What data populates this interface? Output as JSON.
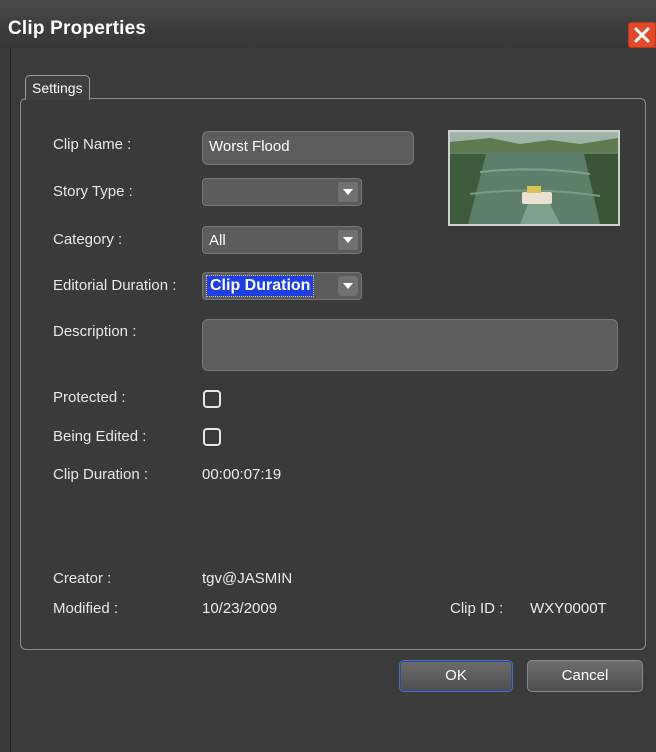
{
  "window": {
    "title": "Clip Properties"
  },
  "tabs": [
    {
      "label": "Settings"
    }
  ],
  "form": {
    "clip_name_label": "Clip Name :",
    "clip_name_value": "Worst Flood",
    "story_type_label": "Story Type :",
    "story_type_value": "",
    "category_label": "Category :",
    "category_value": "All",
    "editorial_duration_label": "Editorial Duration :",
    "editorial_duration_value": "Clip Duration",
    "description_label": "Description :",
    "description_value": "",
    "protected_label": "Protected :",
    "protected_checked": false,
    "being_edited_label": "Being Edited :",
    "being_edited_checked": false,
    "clip_duration_label": "Clip Duration :",
    "clip_duration_value": "00:00:07:19",
    "creator_label": "Creator :",
    "creator_value": "tgv@JASMIN",
    "modified_label": "Modified :",
    "modified_value": "10/23/2009",
    "clip_id_label": "Clip ID :",
    "clip_id_value": "WXY0000T"
  },
  "buttons": {
    "ok": "OK",
    "cancel": "Cancel"
  },
  "icons": {
    "close": "close-icon",
    "dropdown": "chevron-down-icon"
  },
  "colors": {
    "background": "#3a3a3a",
    "close_button": "#e2492b",
    "selection": "#1e3fe6",
    "text": "#e8e8e8"
  }
}
